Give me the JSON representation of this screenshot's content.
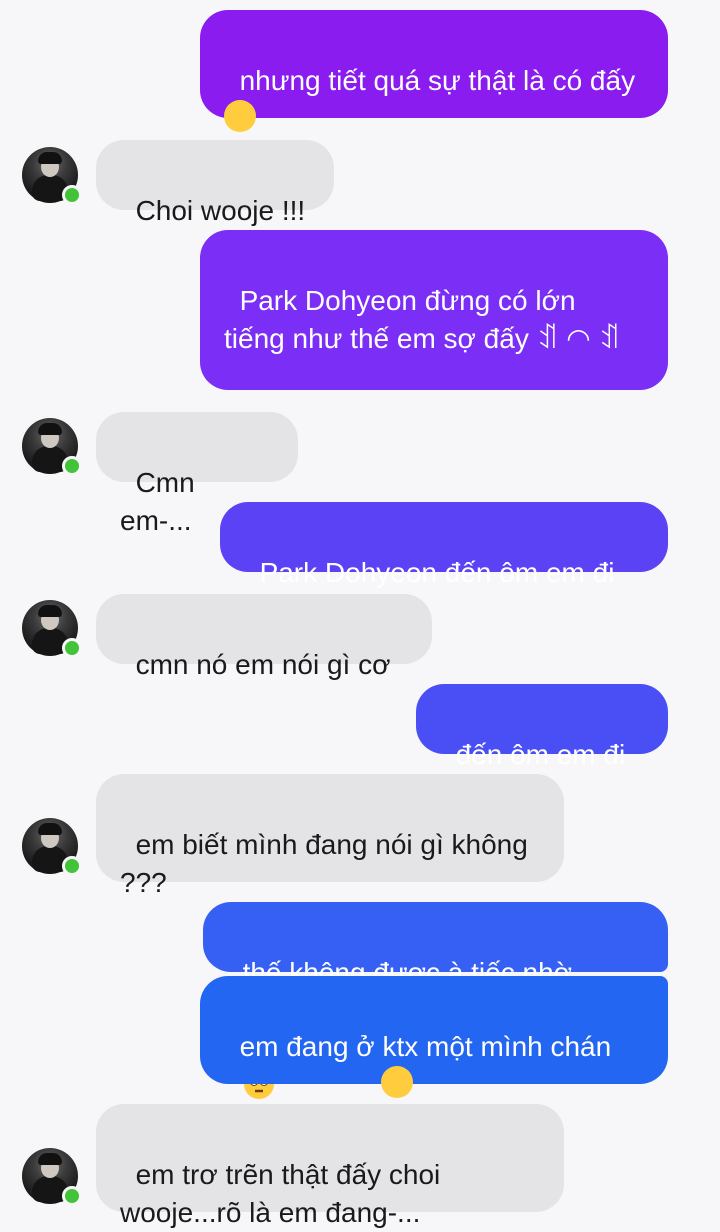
{
  "colors": {
    "background": "#f7f7f9",
    "incoming_bubble": "#e4e4e6",
    "online_indicator": "#42c33a",
    "outgoing_gradient": [
      "#8a1cf0",
      "#7b2ef6",
      "#5b42f4",
      "#4a4ff5",
      "#3560f3",
      "#2366f1"
    ]
  },
  "messages": [
    {
      "side": "out",
      "text": "nhưng tiết quá sự thật là có đấy",
      "emoji": "winking-face"
    },
    {
      "side": "in",
      "text": "Choi wooje !!!"
    },
    {
      "side": "out",
      "text": "Park Dohyeon đừng có lớn tiếng như thế em sợ đấy ꀊ ᠌◠ ꀊ"
    },
    {
      "side": "in",
      "text": "Cmn em-..."
    },
    {
      "side": "out",
      "text": "Park Dohyeon đến ôm em đi"
    },
    {
      "side": "in",
      "text": "cmn nó em nói gì cơ"
    },
    {
      "side": "out",
      "text": "đến ôm em đi"
    },
    {
      "side": "in",
      "text": "em biết mình đang nói gì không ???"
    },
    {
      "side": "out",
      "text": "thế không được à tiếc nhờ",
      "emoji": "face-with-rolling-eyes"
    },
    {
      "side": "out",
      "text": "em đang ở ktx một mình chán chết đi được",
      "emoji": "yawning-face"
    },
    {
      "side": "in",
      "text": "em trơ trẽn thật đấy choi wooje...rõ là em đang-..."
    }
  ]
}
